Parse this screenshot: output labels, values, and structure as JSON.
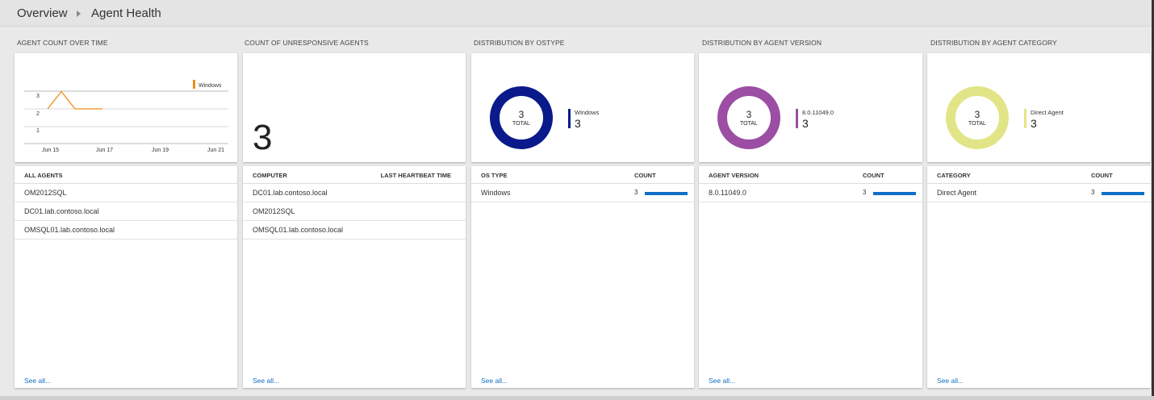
{
  "breadcrumb": {
    "overview": "Overview",
    "current": "Agent Health"
  },
  "blades": {
    "agent_count": {
      "title": "AGENT COUNT OVER TIME",
      "legend": "Windows",
      "list_header": "ALL AGENTS",
      "rows": [
        "OM2012SQL",
        "DC01.lab.contoso.local",
        "OMSQL01.lab.contoso.local"
      ],
      "see_all": "See all..."
    },
    "unresponsive": {
      "title": "COUNT OF UNRESPONSIVE AGENTS",
      "value": "3",
      "header_computer": "COMPUTER",
      "header_heartbeat": "LAST HEARTBEAT TIME",
      "rows": [
        "DC01.lab.contoso.local",
        "OM2012SQL",
        "OMSQL01.lab.contoso.local"
      ],
      "see_all": "See all..."
    },
    "ostype": {
      "title": "DISTRIBUTION BY OSTYPE",
      "total": "3",
      "total_label": "TOTAL",
      "legend_name": "Windows",
      "legend_value": "3",
      "header_left": "OS TYPE",
      "header_right": "COUNT",
      "rows": [
        {
          "label": "Windows",
          "count": "3"
        }
      ],
      "see_all": "See all..."
    },
    "version": {
      "title": "DISTRIBUTION BY AGENT VERSION",
      "total": "3",
      "total_label": "TOTAL",
      "legend_name": "8.0.11049.0",
      "legend_value": "3",
      "header_left": "AGENT VERSION",
      "header_right": "COUNT",
      "rows": [
        {
          "label": "8.0.11049.0",
          "count": "3"
        }
      ],
      "see_all": "See all..."
    },
    "category": {
      "title": "DISTRIBUTION BY AGENT CATEGORY",
      "total": "3",
      "total_label": "TOTAL",
      "legend_name": "Direct Agent",
      "legend_value": "3",
      "header_left": "CATEGORY",
      "header_right": "COUNT",
      "rows": [
        {
          "label": "Direct Agent",
          "count": "3"
        }
      ],
      "see_all": "See all..."
    }
  },
  "colors": {
    "windows_line": "#f28a1b",
    "ostype_donut": "#0a1a8a",
    "version_donut": "#9b4ea3",
    "category_donut": "#e2e587",
    "bar": "#0f6fc6",
    "link": "#0f6fc6"
  },
  "chart_data": {
    "type": "line",
    "x": [
      "Jun 15",
      "Jun 15.5",
      "Jun 16",
      "Jun 16.5"
    ],
    "series": [
      {
        "name": "Windows",
        "values": [
          2,
          3,
          2,
          2
        ]
      }
    ],
    "x_tick_labels": [
      "Jun 15",
      "Jun 17",
      "Jun 19",
      "Jun 21"
    ],
    "y_tick_labels": [
      "1",
      "2",
      "3"
    ],
    "ylim": [
      0,
      4
    ],
    "grid": true,
    "legend": "top-right"
  }
}
